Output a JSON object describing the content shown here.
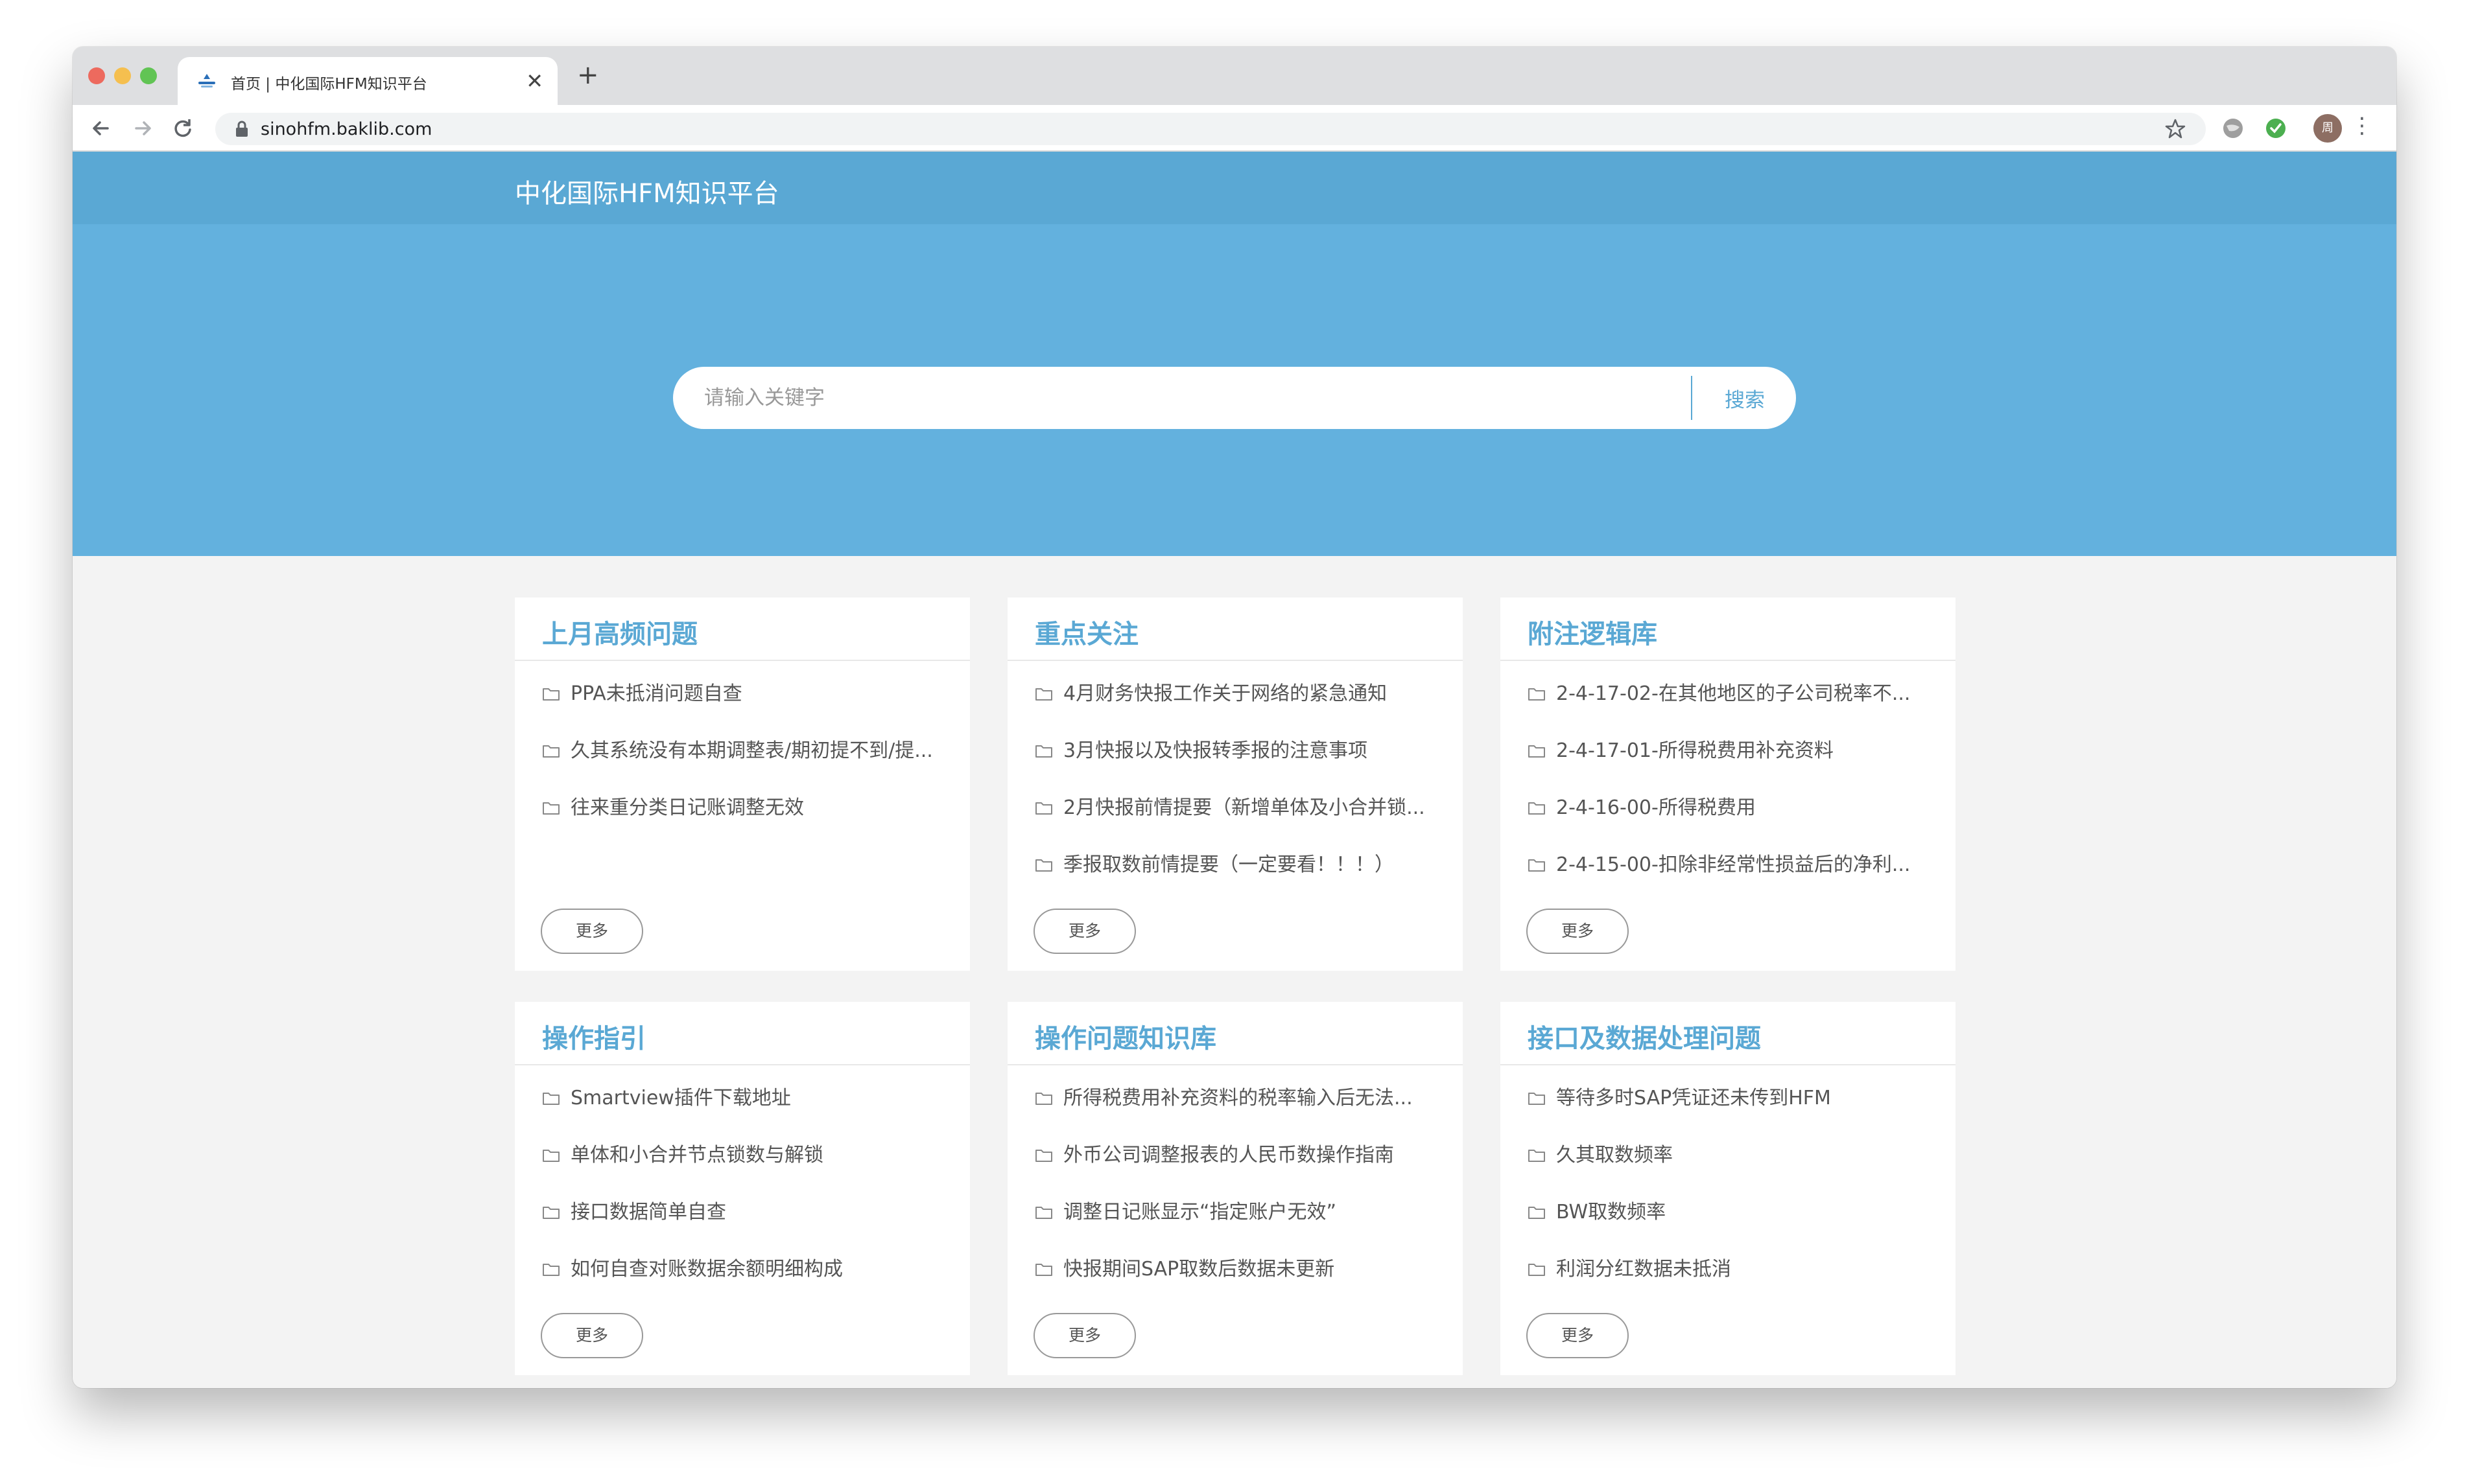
{
  "browser": {
    "tab_title": "首页 | 中化国际HFM知识平台",
    "tab_close": "✕",
    "new_tab": "+",
    "url": "sinohfm.baklib.com",
    "avatar_text": "周"
  },
  "site": {
    "title": "中化国际HFM知识平台",
    "search_placeholder": "请输入关键字",
    "search_button": "搜索"
  },
  "cards": [
    {
      "title": "上月高频问题",
      "items": [
        "PPA未抵消问题自查",
        "久其系统没有本期调整表/期初提不到/提...",
        "往来重分类日记账调整无效"
      ],
      "more": "更多"
    },
    {
      "title": "重点关注",
      "items": [
        "4月财务快报工作关于网络的紧急通知",
        "3月快报以及快报转季报的注意事项",
        "2月快报前情提要（新增单体及小合并锁...",
        "季报取数前情提要（一定要看！！！）"
      ],
      "more": "更多"
    },
    {
      "title": "附注逻辑库",
      "items": [
        "2-4-17-02-在其他地区的子公司税率不...",
        "2-4-17-01-所得税费用补充资料",
        "2-4-16-00-所得税费用",
        "2-4-15-00-扣除非经常性损益后的净利..."
      ],
      "more": "更多"
    },
    {
      "title": "操作指引",
      "items": [
        "Smartview插件下载地址",
        "单体和小合并节点锁数与解锁",
        "接口数据简单自查",
        "如何自查对账数据余额明细构成"
      ],
      "more": "更多"
    },
    {
      "title": "操作问题知识库",
      "items": [
        "所得税费用补充资料的税率输入后无法...",
        "外币公司调整报表的人民币数操作指南",
        "调整日记账显示“指定账户无效”",
        "快报期间SAP取数后数据未更新"
      ],
      "more": "更多"
    },
    {
      "title": "接口及数据处理问题",
      "items": [
        "等待多时SAP凭证还未传到HFM",
        "久其取数频率",
        "BW取数频率",
        "利润分红数据未抵消"
      ],
      "more": "更多"
    }
  ],
  "colors": {
    "header": "#5aa8d4",
    "hero": "#63b1de",
    "accent": "#5aa8d4"
  }
}
